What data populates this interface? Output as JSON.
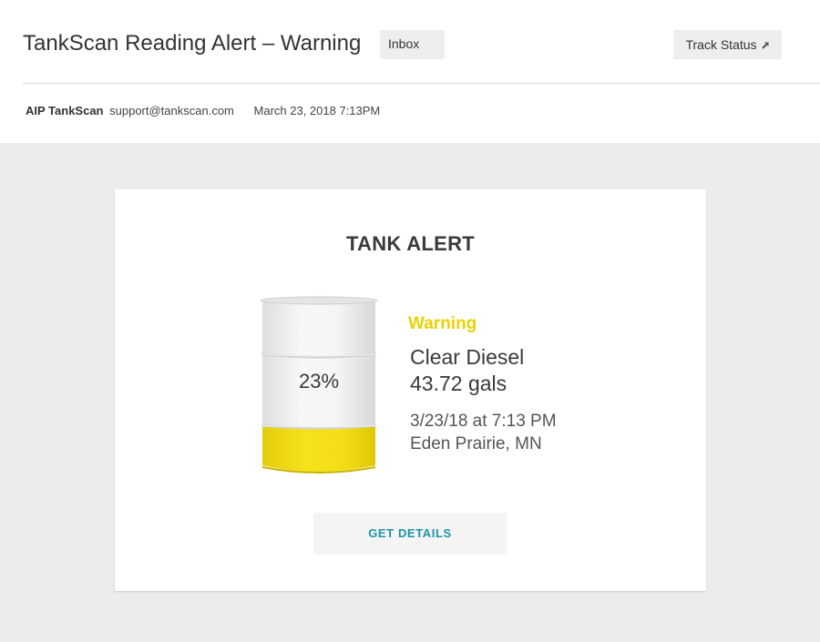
{
  "email": {
    "subject": "TankScan Reading Alert – Warning",
    "folder_badge": "Inbox",
    "track_button_label": "Track Status",
    "sender": {
      "name": "AIP TankScan",
      "email": "support@tankscan.com"
    },
    "date": "March 23, 2018  7:13PM"
  },
  "alert": {
    "title": "TANK ALERT",
    "fill_percent_label": "23%",
    "fill_level": 0.23,
    "status": "Warning",
    "product": "Clear Diesel",
    "volume": "43.72 gals",
    "reading_time": "3/23/18 at 7:13 PM",
    "location": "Eden Prairie, MN",
    "details_button_label": "GET DETAILS"
  },
  "colors": {
    "page_background": "#ebeced",
    "warning_yellow": "#e8d200",
    "fuel_yellow": "#f0dc18",
    "link_teal": "#1b93a7",
    "badge_gray": "#eeeeee"
  },
  "icons": {
    "track_status": "external-link-arrow-icon"
  }
}
